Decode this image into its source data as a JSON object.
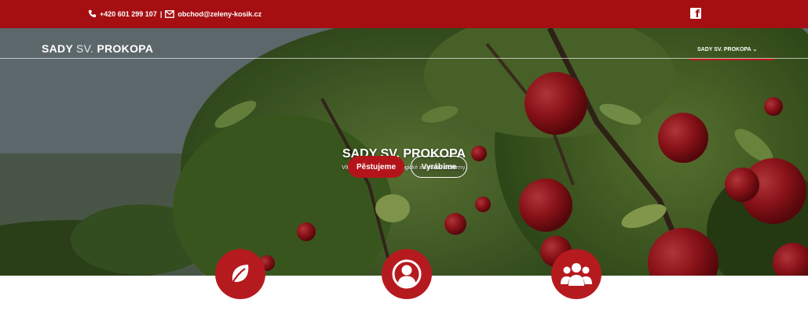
{
  "topbar": {
    "phone": "+420 601 299 107",
    "separator": "|",
    "email": "obchod@zeleny-kosik.cz",
    "facebook_glyph": "f",
    "background": "#a50f12"
  },
  "nav": {
    "brand_left": "SADY",
    "brand_mid": "SV.",
    "brand_right": "PROKOPA",
    "menu_label": "SADY SV. PROKOPA",
    "menu_caret": "⌄"
  },
  "hero": {
    "title": "SADY SV. PROKOPA",
    "subtitle": "Vítejte na stránkách ekologické a sociální biofarmy.",
    "primary_button": "Pěstujeme",
    "secondary_button": "Vyrábíme"
  },
  "features": [
    {
      "icon": "leaf-icon"
    },
    {
      "icon": "user-icon"
    },
    {
      "icon": "group-icon"
    }
  ],
  "colors": {
    "brand_red": "#b3141a",
    "apple_red": "#b01820",
    "leaf_green": "#4f7a2c"
  }
}
